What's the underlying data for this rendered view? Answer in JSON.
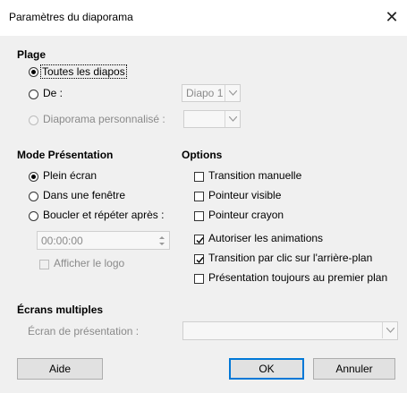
{
  "window": {
    "title": "Paramètres du diaporama",
    "close_glyph": "✕"
  },
  "range": {
    "header": "Plage",
    "all": "Toutes les diapos",
    "from": "De :",
    "from_value": "Diapo 1",
    "custom": "Diaporama personnalisé :",
    "custom_value": ""
  },
  "mode": {
    "header": "Mode Présentation",
    "full": "Plein écran",
    "window": "Dans une fenêtre",
    "loop": "Boucler et répéter après :",
    "loop_time": "00:00:00",
    "show_logo": "Afficher le logo"
  },
  "options": {
    "header": "Options",
    "items": [
      {
        "label": "Transition manuelle",
        "checked": false
      },
      {
        "label": "Pointeur visible",
        "checked": false
      },
      {
        "label": "Pointeur crayon",
        "checked": false
      },
      {
        "label": "Autoriser les animations",
        "checked": true
      },
      {
        "label": "Transition par clic sur l'arrière-plan",
        "checked": true
      },
      {
        "label": "Présentation toujours au premier plan",
        "checked": false
      }
    ]
  },
  "multi": {
    "header": "Écrans multiples",
    "screen_label": "Écran de présentation :",
    "screen_value": ""
  },
  "buttons": {
    "help": "Aide",
    "ok": "OK",
    "cancel": "Annuler"
  },
  "colors": {
    "accent": "#0078d7",
    "dialog_bg": "#f0f0f0"
  }
}
